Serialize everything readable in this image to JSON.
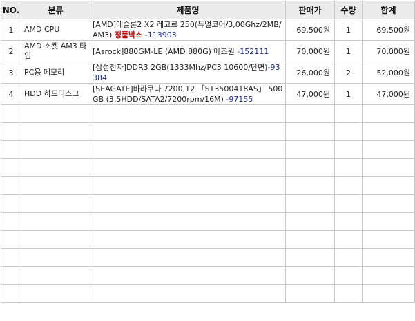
{
  "headers": {
    "no": "NO.",
    "category": "분류",
    "product": "제품명",
    "price": "판매가",
    "qty": "수량",
    "total": "합계"
  },
  "rows": [
    {
      "no": "1",
      "category": "AMD CPU",
      "product": "[AMD]애슬론2 X2 레고르 250(듀얼코어/3,00Ghz/2MB/AM3)",
      "gift": "정품박스",
      "code": "-113903",
      "price": "69,500원",
      "qty": "1",
      "total": "69,500원"
    },
    {
      "no": "2",
      "category": "AMD 소켓 AM3 타입",
      "product": "[Asrock]880GM-LE (AMD 880G) 에즈원",
      "gift": "",
      "code": "-152111",
      "price": "70,000원",
      "qty": "1",
      "total": "70,000원"
    },
    {
      "no": "3",
      "category": "PC용 메모리",
      "product": "[삼성전자]DDR3 2GB(1333Mhz/PC3 10600/단면)",
      "gift": "",
      "code": "-93384",
      "price": "26,000원",
      "qty": "2",
      "total": "52,000원"
    },
    {
      "no": "4",
      "category": "HDD 하드디스크",
      "product": "[SEAGATE]바라쿠다 7200,12 「ST3500418AS」 500GB (3,5HDD/SATA2/7200rpm/16M)",
      "gift": "",
      "code": "-97155",
      "price": "47,000원",
      "qty": "1",
      "total": "47,000원"
    }
  ]
}
